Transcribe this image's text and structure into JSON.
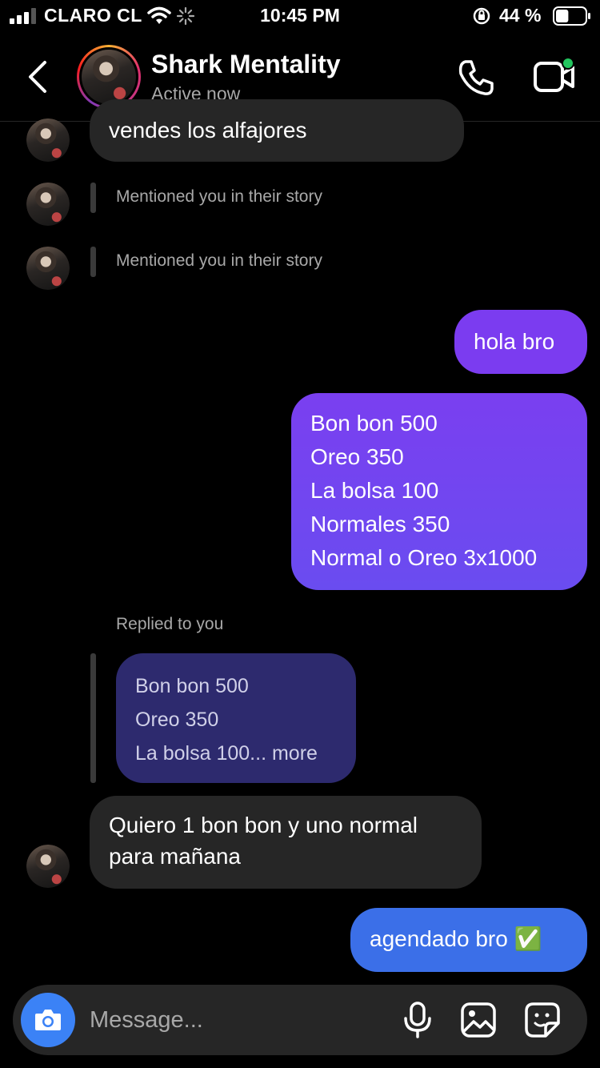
{
  "status_bar": {
    "carrier": "CLARO CL",
    "time": "10:45 PM",
    "battery_text": "44 %",
    "battery_level": 0.44
  },
  "header": {
    "name": "Shark Mentality",
    "status": "Active now"
  },
  "messages": {
    "m1": "vendes los alfajores",
    "mention1": "Mentioned you in their story",
    "mention2": "Mentioned you in their story",
    "out1": "hola bro",
    "out2": [
      "Bon bon 500",
      "Oreo 350",
      "La bolsa 100",
      "Normales 350",
      "Normal o Oreo 3x1000"
    ],
    "replied_label": "Replied to you",
    "quoted": [
      "Bon bon 500",
      "Oreo 350",
      "La bolsa 100... more"
    ],
    "in2": [
      "Quiero 1 bon bon y uno normal",
      "para mañana"
    ],
    "out3": "agendado bro ✅"
  },
  "composer": {
    "placeholder": "Message..."
  },
  "colors": {
    "accent_blue": "#3b82f6",
    "bubble_purple": "#7c3aed",
    "bubble_incoming": "#262626",
    "online_dot": "#22c55e"
  }
}
